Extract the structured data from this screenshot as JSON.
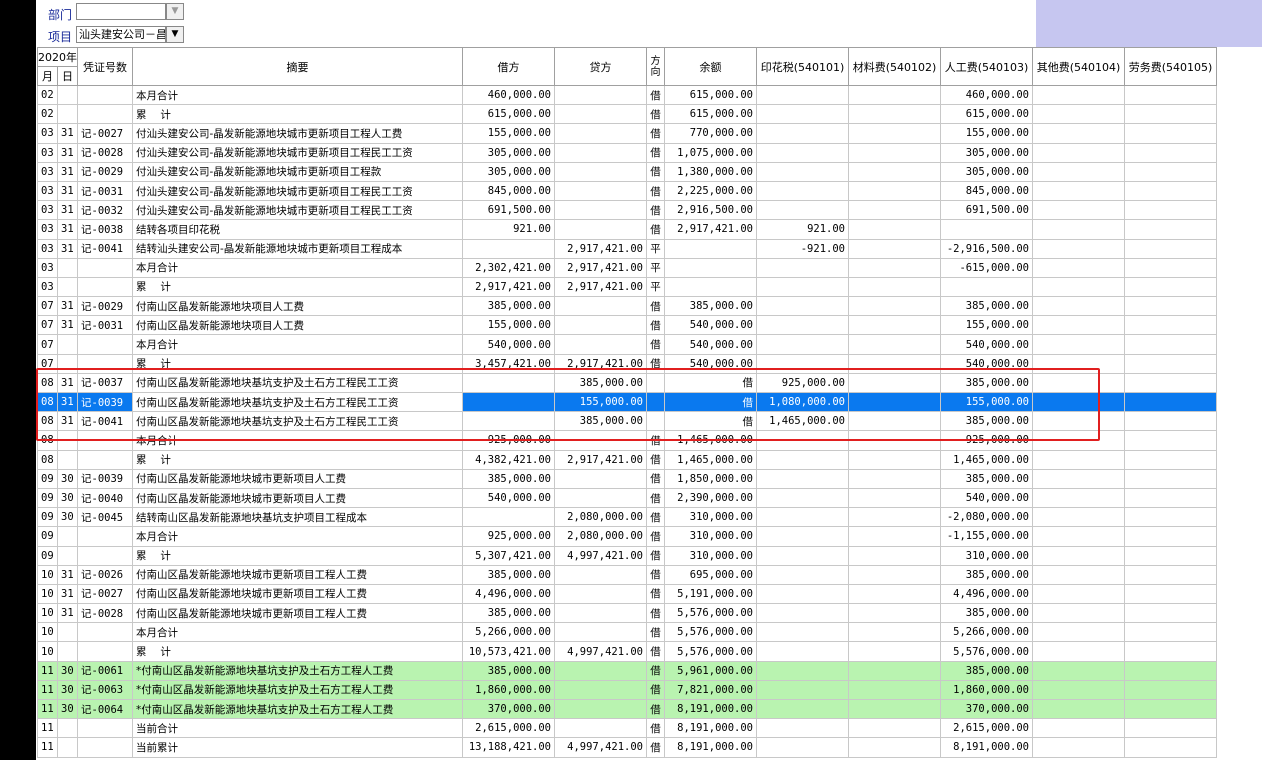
{
  "filters": {
    "dept_label": "部门",
    "dept_value": "",
    "project_label": "项目",
    "project_value": "汕头建安公司－昌",
    "dropdown_glyph": "▼"
  },
  "header": {
    "year": "2020年",
    "month": "月",
    "day": "日",
    "voucher": "凭证号数",
    "summary": "摘要",
    "debit": "借方",
    "credit": "贷方",
    "direction": "方向",
    "balance": "余额",
    "stamp_tax": "印花税(540101)",
    "material": "材料费(540102)",
    "labor": "人工费(540103)",
    "other": "其他费(540104)",
    "service": "劳务费(540105)"
  },
  "rows": [
    {
      "m": "02",
      "d": "",
      "v": "",
      "s": "本月合计",
      "dr": "460,000.00",
      "cr": "",
      "dir": "借",
      "bal": "615,000.00",
      "tax": "",
      "mat": "",
      "lab": "460,000.00",
      "oth": "",
      "svc": "",
      "style": ""
    },
    {
      "m": "02",
      "d": "",
      "v": "",
      "s": "累　 计",
      "dr": "615,000.00",
      "cr": "",
      "dir": "借",
      "bal": "615,000.00",
      "tax": "",
      "mat": "",
      "lab": "615,000.00",
      "oth": "",
      "svc": "",
      "style": ""
    },
    {
      "m": "03",
      "d": "31",
      "v": "记-0027",
      "s": "付汕头建安公司-晶发新能源地块城市更新项目工程人工费",
      "dr": "155,000.00",
      "cr": "",
      "dir": "借",
      "bal": "770,000.00",
      "tax": "",
      "mat": "",
      "lab": "155,000.00",
      "oth": "",
      "svc": "",
      "style": ""
    },
    {
      "m": "03",
      "d": "31",
      "v": "记-0028",
      "s": "付汕头建安公司-晶发新能源地块城市更新项目工程民工工资",
      "dr": "305,000.00",
      "cr": "",
      "dir": "借",
      "bal": "1,075,000.00",
      "tax": "",
      "mat": "",
      "lab": "305,000.00",
      "oth": "",
      "svc": "",
      "style": ""
    },
    {
      "m": "03",
      "d": "31",
      "v": "记-0029",
      "s": "付汕头建安公司-晶发新能源地块城市更新项目工程款",
      "dr": "305,000.00",
      "cr": "",
      "dir": "借",
      "bal": "1,380,000.00",
      "tax": "",
      "mat": "",
      "lab": "305,000.00",
      "oth": "",
      "svc": "",
      "style": ""
    },
    {
      "m": "03",
      "d": "31",
      "v": "记-0031",
      "s": "付汕头建安公司-晶发新能源地块城市更新项目工程民工工资",
      "dr": "845,000.00",
      "cr": "",
      "dir": "借",
      "bal": "2,225,000.00",
      "tax": "",
      "mat": "",
      "lab": "845,000.00",
      "oth": "",
      "svc": "",
      "style": ""
    },
    {
      "m": "03",
      "d": "31",
      "v": "记-0032",
      "s": "付汕头建安公司-晶发新能源地块城市更新项目工程民工工资",
      "dr": "691,500.00",
      "cr": "",
      "dir": "借",
      "bal": "2,916,500.00",
      "tax": "",
      "mat": "",
      "lab": "691,500.00",
      "oth": "",
      "svc": "",
      "style": ""
    },
    {
      "m": "03",
      "d": "31",
      "v": "记-0038",
      "s": "结转各项目印花税",
      "dr": "921.00",
      "cr": "",
      "dir": "借",
      "bal": "2,917,421.00",
      "tax": "921.00",
      "mat": "",
      "lab": "",
      "oth": "",
      "svc": "",
      "style": ""
    },
    {
      "m": "03",
      "d": "31",
      "v": "记-0041",
      "s": "结转汕头建安公司-晶发新能源地块城市更新项目工程成本",
      "dr": "",
      "cr": "2,917,421.00",
      "dir": "平",
      "bal": "",
      "tax": "-921.00",
      "mat": "",
      "lab": "-2,916,500.00",
      "oth": "",
      "svc": "",
      "style": ""
    },
    {
      "m": "03",
      "d": "",
      "v": "",
      "s": "本月合计",
      "dr": "2,302,421.00",
      "cr": "2,917,421.00",
      "dir": "平",
      "bal": "",
      "tax": "",
      "mat": "",
      "lab": "-615,000.00",
      "oth": "",
      "svc": "",
      "style": ""
    },
    {
      "m": "03",
      "d": "",
      "v": "",
      "s": "累　 计",
      "dr": "2,917,421.00",
      "cr": "2,917,421.00",
      "dir": "平",
      "bal": "",
      "tax": "",
      "mat": "",
      "lab": "",
      "oth": "",
      "svc": "",
      "style": ""
    },
    {
      "m": "07",
      "d": "31",
      "v": "记-0029",
      "s": "付南山区晶发新能源地块项目人工费",
      "dr": "385,000.00",
      "cr": "",
      "dir": "借",
      "bal": "385,000.00",
      "tax": "",
      "mat": "",
      "lab": "385,000.00",
      "oth": "",
      "svc": "",
      "style": ""
    },
    {
      "m": "07",
      "d": "31",
      "v": "记-0031",
      "s": "付南山区晶发新能源地块项目人工费",
      "dr": "155,000.00",
      "cr": "",
      "dir": "借",
      "bal": "540,000.00",
      "tax": "",
      "mat": "",
      "lab": "155,000.00",
      "oth": "",
      "svc": "",
      "style": ""
    },
    {
      "m": "07",
      "d": "",
      "v": "",
      "s": "本月合计",
      "dr": "540,000.00",
      "cr": "",
      "dir": "借",
      "bal": "540,000.00",
      "tax": "",
      "mat": "",
      "lab": "540,000.00",
      "oth": "",
      "svc": "",
      "style": ""
    },
    {
      "m": "07",
      "d": "",
      "v": "",
      "s": "累　 计",
      "dr": "3,457,421.00",
      "cr": "2,917,421.00",
      "dir": "借",
      "bal": "540,000.00",
      "tax": "",
      "mat": "",
      "lab": "540,000.00",
      "oth": "",
      "svc": "",
      "style": ""
    },
    {
      "m": "08",
      "d": "31",
      "v": "记-0037",
      "s": "付南山区晶发新能源地块基坑支护及土石方工程民工工资",
      "dr": "",
      "cr": "385,000.00",
      "dir": "",
      "bal": "借",
      "tax": "925,000.00",
      "mat": "",
      "lab": "385,000.00",
      "oth": "",
      "svc": "",
      "style": ""
    },
    {
      "m": "08",
      "d": "31",
      "v": "记-0039",
      "s": "付南山区晶发新能源地块基坑支护及土石方工程民工工资",
      "dr": "",
      "cr": "155,000.00",
      "dir": "",
      "bal": "借",
      "tax": "1,080,000.00",
      "mat": "",
      "lab": "155,000.00",
      "oth": "",
      "svc": "",
      "style": "sel"
    },
    {
      "m": "08",
      "d": "31",
      "v": "记-0041",
      "s": "付南山区晶发新能源地块基坑支护及土石方工程民工工资",
      "dr": "",
      "cr": "385,000.00",
      "dir": "",
      "bal": "借",
      "tax": "1,465,000.00",
      "mat": "",
      "lab": "385,000.00",
      "oth": "",
      "svc": "",
      "style": ""
    },
    {
      "m": "08",
      "d": "",
      "v": "",
      "s": "本月合计",
      "dr": "925,000.00",
      "cr": "",
      "dir": "借",
      "bal": "1,465,000.00",
      "tax": "",
      "mat": "",
      "lab": "925,000.00",
      "oth": "",
      "svc": "",
      "style": ""
    },
    {
      "m": "08",
      "d": "",
      "v": "",
      "s": "累　 计",
      "dr": "4,382,421.00",
      "cr": "2,917,421.00",
      "dir": "借",
      "bal": "1,465,000.00",
      "tax": "",
      "mat": "",
      "lab": "1,465,000.00",
      "oth": "",
      "svc": "",
      "style": ""
    },
    {
      "m": "09",
      "d": "30",
      "v": "记-0039",
      "s": "付南山区晶发新能源地块城市更新项目人工费",
      "dr": "385,000.00",
      "cr": "",
      "dir": "借",
      "bal": "1,850,000.00",
      "tax": "",
      "mat": "",
      "lab": "385,000.00",
      "oth": "",
      "svc": "",
      "style": ""
    },
    {
      "m": "09",
      "d": "30",
      "v": "记-0040",
      "s": "付南山区晶发新能源地块城市更新项目人工费",
      "dr": "540,000.00",
      "cr": "",
      "dir": "借",
      "bal": "2,390,000.00",
      "tax": "",
      "mat": "",
      "lab": "540,000.00",
      "oth": "",
      "svc": "",
      "style": ""
    },
    {
      "m": "09",
      "d": "30",
      "v": "记-0045",
      "s": "结转南山区晶发新能源地块基坑支护项目工程成本",
      "dr": "",
      "cr": "2,080,000.00",
      "dir": "借",
      "bal": "310,000.00",
      "tax": "",
      "mat": "",
      "lab": "-2,080,000.00",
      "oth": "",
      "svc": "",
      "style": ""
    },
    {
      "m": "09",
      "d": "",
      "v": "",
      "s": "本月合计",
      "dr": "925,000.00",
      "cr": "2,080,000.00",
      "dir": "借",
      "bal": "310,000.00",
      "tax": "",
      "mat": "",
      "lab": "-1,155,000.00",
      "oth": "",
      "svc": "",
      "style": ""
    },
    {
      "m": "09",
      "d": "",
      "v": "",
      "s": "累　 计",
      "dr": "5,307,421.00",
      "cr": "4,997,421.00",
      "dir": "借",
      "bal": "310,000.00",
      "tax": "",
      "mat": "",
      "lab": "310,000.00",
      "oth": "",
      "svc": "",
      "style": ""
    },
    {
      "m": "10",
      "d": "31",
      "v": "记-0026",
      "s": "付南山区晶发新能源地块城市更新项目工程人工费",
      "dr": "385,000.00",
      "cr": "",
      "dir": "借",
      "bal": "695,000.00",
      "tax": "",
      "mat": "",
      "lab": "385,000.00",
      "oth": "",
      "svc": "",
      "style": ""
    },
    {
      "m": "10",
      "d": "31",
      "v": "记-0027",
      "s": "付南山区晶发新能源地块城市更新项目工程人工费",
      "dr": "4,496,000.00",
      "cr": "",
      "dir": "借",
      "bal": "5,191,000.00",
      "tax": "",
      "mat": "",
      "lab": "4,496,000.00",
      "oth": "",
      "svc": "",
      "style": ""
    },
    {
      "m": "10",
      "d": "31",
      "v": "记-0028",
      "s": "付南山区晶发新能源地块城市更新项目工程人工费",
      "dr": "385,000.00",
      "cr": "",
      "dir": "借",
      "bal": "5,576,000.00",
      "tax": "",
      "mat": "",
      "lab": "385,000.00",
      "oth": "",
      "svc": "",
      "style": ""
    },
    {
      "m": "10",
      "d": "",
      "v": "",
      "s": "本月合计",
      "dr": "5,266,000.00",
      "cr": "",
      "dir": "借",
      "bal": "5,576,000.00",
      "tax": "",
      "mat": "",
      "lab": "5,266,000.00",
      "oth": "",
      "svc": "",
      "style": ""
    },
    {
      "m": "10",
      "d": "",
      "v": "",
      "s": "累　 计",
      "dr": "10,573,421.00",
      "cr": "4,997,421.00",
      "dir": "借",
      "bal": "5,576,000.00",
      "tax": "",
      "mat": "",
      "lab": "5,576,000.00",
      "oth": "",
      "svc": "",
      "style": ""
    },
    {
      "m": "11",
      "d": "30",
      "v": "记-0061",
      "s": "*付南山区晶发新能源地块基坑支护及土石方工程人工费",
      "dr": "385,000.00",
      "cr": "",
      "dir": "借",
      "bal": "5,961,000.00",
      "tax": "",
      "mat": "",
      "lab": "385,000.00",
      "oth": "",
      "svc": "",
      "style": "green"
    },
    {
      "m": "11",
      "d": "30",
      "v": "记-0063",
      "s": "*付南山区晶发新能源地块基坑支护及土石方工程人工费",
      "dr": "1,860,000.00",
      "cr": "",
      "dir": "借",
      "bal": "7,821,000.00",
      "tax": "",
      "mat": "",
      "lab": "1,860,000.00",
      "oth": "",
      "svc": "",
      "style": "green"
    },
    {
      "m": "11",
      "d": "30",
      "v": "记-0064",
      "s": "*付南山区晶发新能源地块基坑支护及土石方工程人工费",
      "dr": "370,000.00",
      "cr": "",
      "dir": "借",
      "bal": "8,191,000.00",
      "tax": "",
      "mat": "",
      "lab": "370,000.00",
      "oth": "",
      "svc": "",
      "style": "green"
    },
    {
      "m": "11",
      "d": "",
      "v": "",
      "s": "当前合计",
      "dr": "2,615,000.00",
      "cr": "",
      "dir": "借",
      "bal": "8,191,000.00",
      "tax": "",
      "mat": "",
      "lab": "2,615,000.00",
      "oth": "",
      "svc": "",
      "style": ""
    },
    {
      "m": "11",
      "d": "",
      "v": "",
      "s": "当前累计",
      "dr": "13,188,421.00",
      "cr": "4,997,421.00",
      "dir": "借",
      "bal": "8,191,000.00",
      "tax": "",
      "mat": "",
      "lab": "8,191,000.00",
      "oth": "",
      "svc": "",
      "style": ""
    }
  ]
}
